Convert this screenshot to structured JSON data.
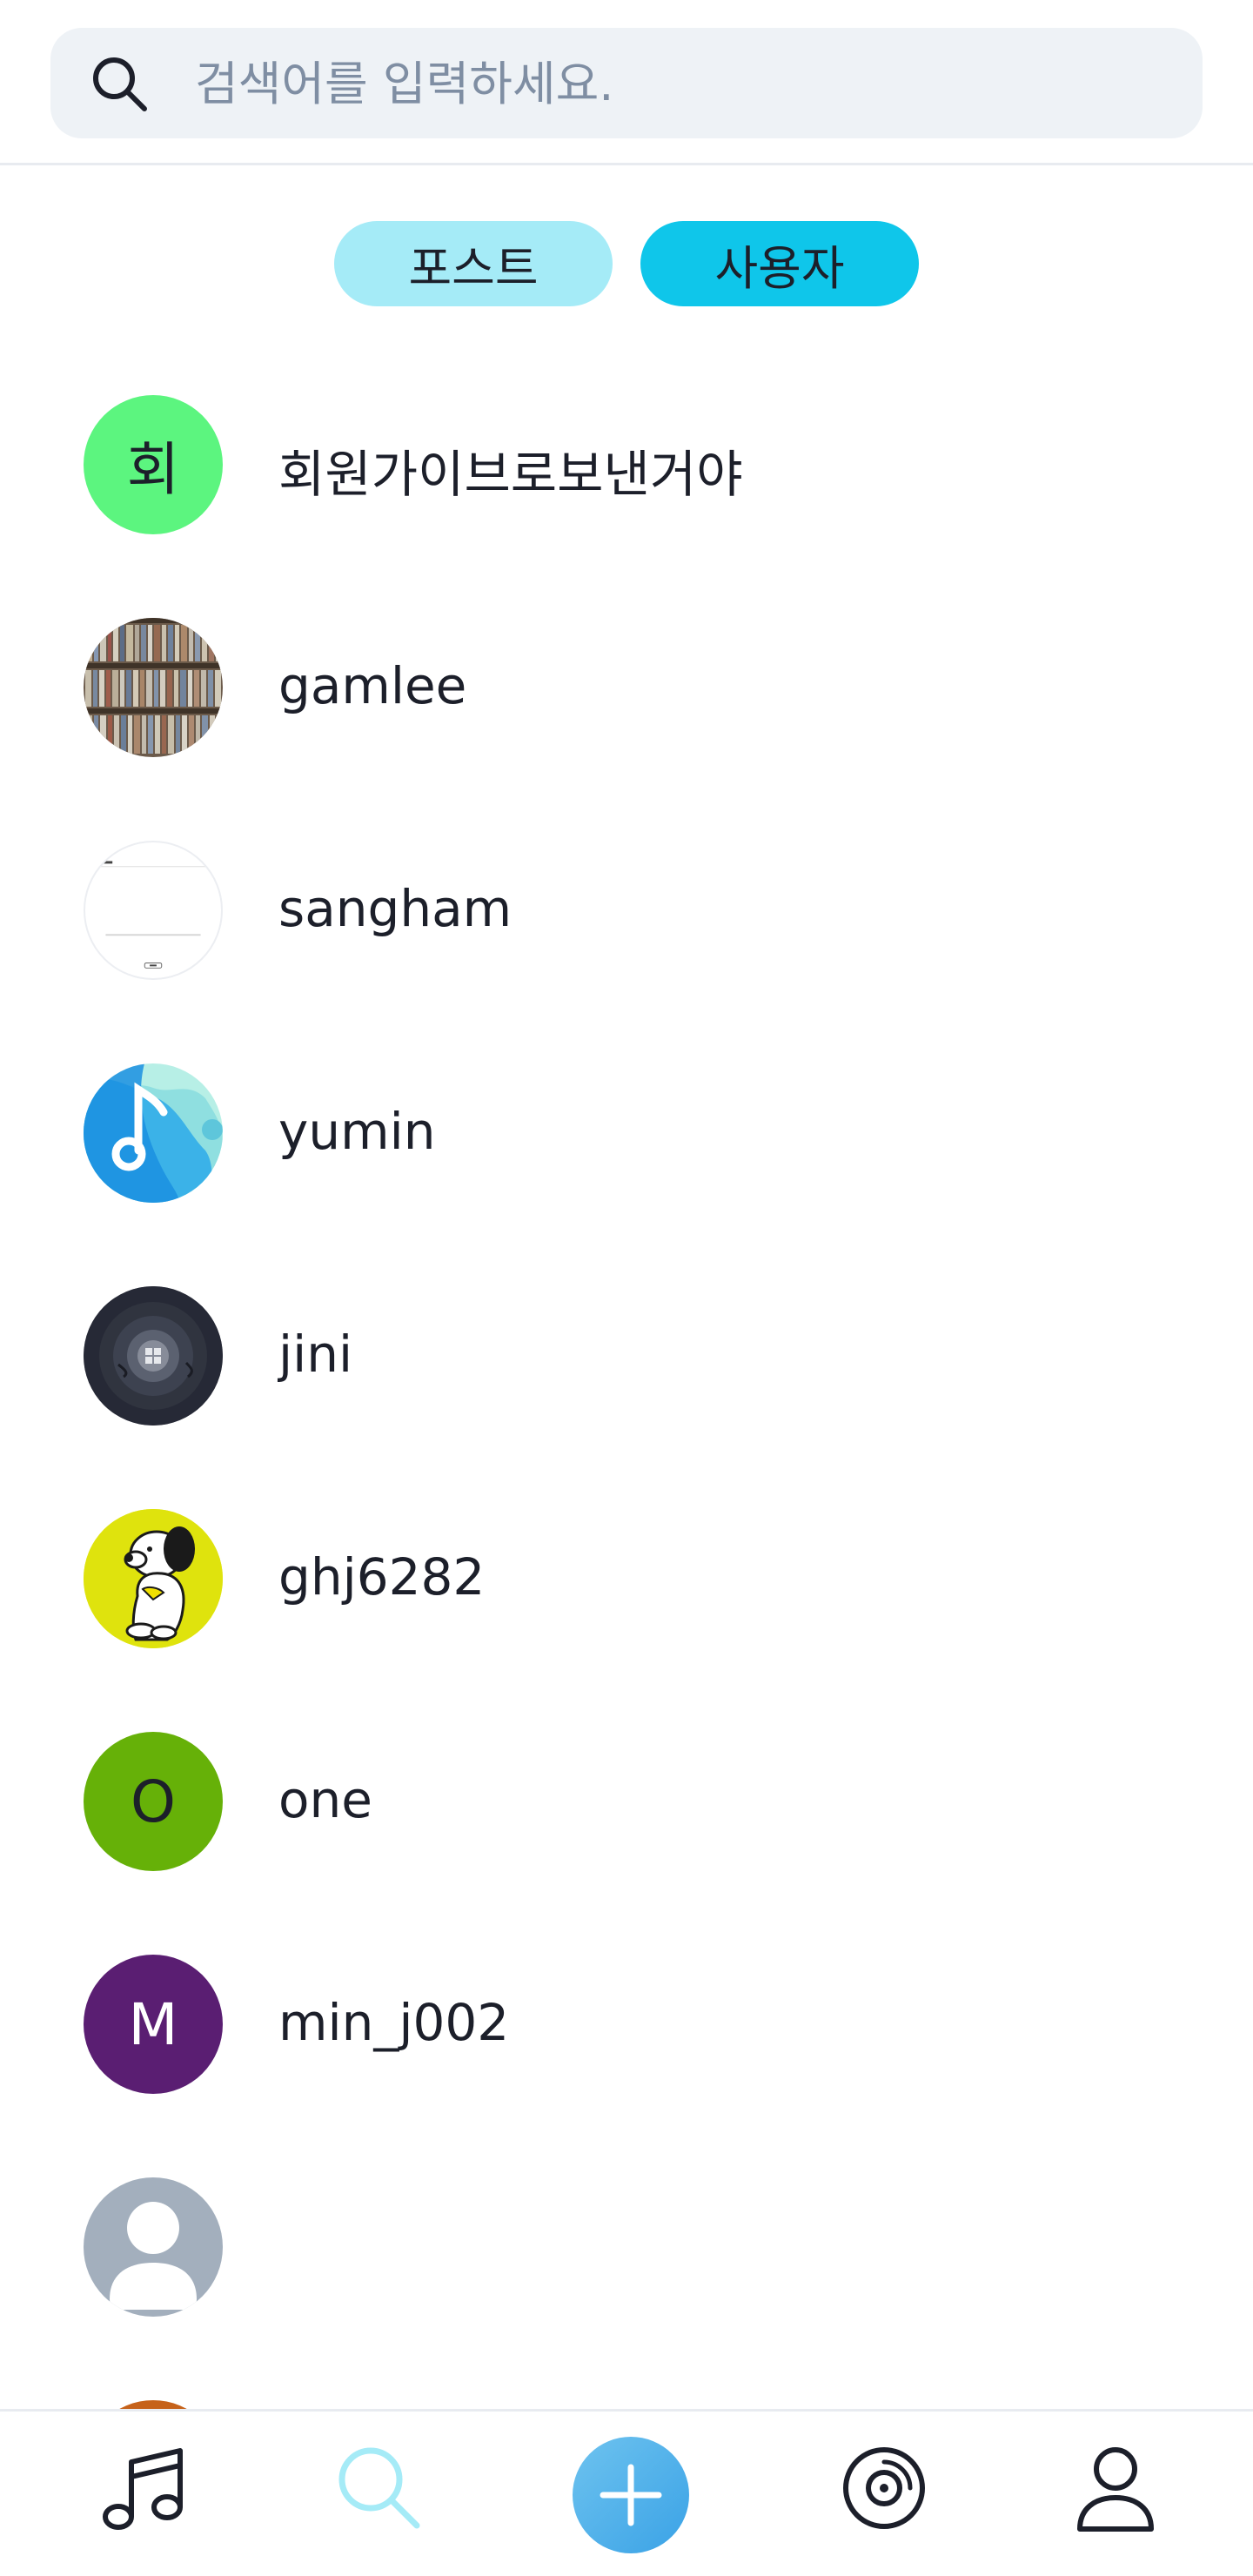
{
  "search": {
    "placeholder": "검색어를 입력하세요.",
    "value": ""
  },
  "tabs": [
    {
      "label": "포스트",
      "active": false
    },
    {
      "label": "사용자",
      "active": true
    }
  ],
  "users": [
    {
      "name": "회원가이브로보낸거야",
      "avatar_type": "initial",
      "initial": "회",
      "avatar_color": "#5cf57f"
    },
    {
      "name": "gamlee",
      "avatar_type": "photo",
      "avatar_icon": "record-shelf-photo"
    },
    {
      "name": "sangham",
      "avatar_type": "photo",
      "avatar_icon": "screenshot-photo"
    },
    {
      "name": "yumin",
      "avatar_type": "photo",
      "avatar_icon": "music-note-photo"
    },
    {
      "name": "jini",
      "avatar_type": "photo",
      "avatar_icon": "dark-disc-photo"
    },
    {
      "name": "ghj6282",
      "avatar_type": "photo",
      "avatar_icon": "snoopy-photo"
    },
    {
      "name": "one",
      "avatar_type": "initial",
      "initial": "O",
      "avatar_color": "#66b108"
    },
    {
      "name": "min_j002",
      "avatar_type": "initial",
      "initial": "M",
      "avatar_color": "#5a1e72"
    },
    {
      "name": "",
      "avatar_type": "default",
      "avatar_icon": "default-person-icon",
      "avatar_color": "#a3afbd"
    }
  ],
  "bottom_nav": [
    {
      "icon": "music-notes-icon",
      "active": false
    },
    {
      "icon": "search-icon",
      "active": true,
      "color": "#a5ebf7"
    },
    {
      "icon": "plus-icon",
      "active": false
    },
    {
      "icon": "vinyl-icon",
      "active": false
    },
    {
      "icon": "profile-icon",
      "active": false
    }
  ],
  "colors": {
    "accent": "#0fc6ea",
    "accent_light": "#a5ebf7",
    "text": "#1c1f2a",
    "placeholder": "#7f8ea3",
    "search_bg": "#eef2f6"
  }
}
